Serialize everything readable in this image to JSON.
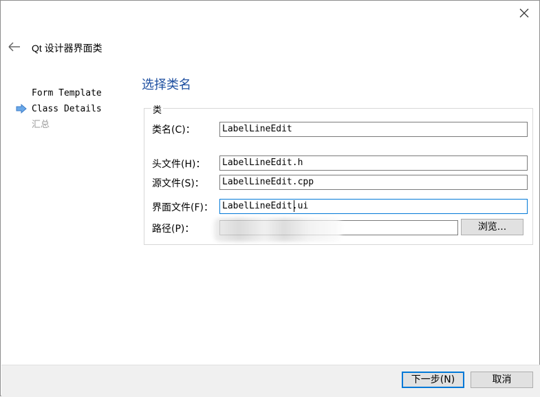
{
  "window": {
    "title": "Qt 设计器界面类"
  },
  "steps": [
    {
      "label": "Form Template",
      "state": "done"
    },
    {
      "label": "Class Details",
      "state": "current"
    },
    {
      "label": "汇总",
      "state": "todo"
    }
  ],
  "section_title": "选择类名",
  "group_title": "类",
  "fields": {
    "class_name": {
      "label": "类名(C)：",
      "value": "LabelLineEdit"
    },
    "header_file": {
      "label": "头文件(H)：",
      "value": "LabelLineEdit.h"
    },
    "source_file": {
      "label": "源文件(S)：",
      "value": "LabelLineEdit.cpp"
    },
    "form_file": {
      "label": "界面文件(F)：",
      "value": "LabelLineEdit.ui"
    },
    "path": {
      "label": "路径(P)：",
      "value": ""
    }
  },
  "buttons": {
    "browse": "浏览...",
    "next": "下一步(N)",
    "cancel": "取消"
  },
  "colors": {
    "accent": "#0078d7",
    "section_title": "#1e4fa0"
  },
  "icons": {
    "close": "close-icon",
    "back": "back-arrow-icon",
    "current_step": "current-step-arrow-icon"
  }
}
